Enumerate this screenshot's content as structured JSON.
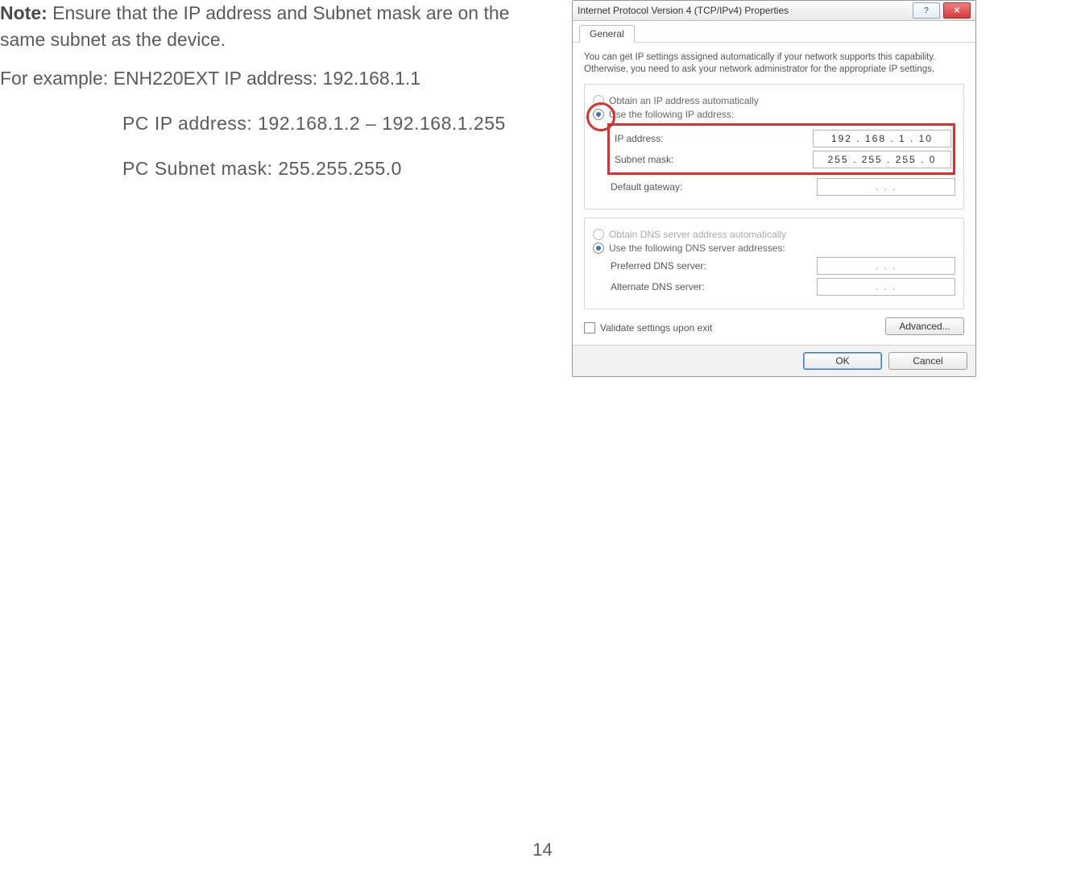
{
  "doc": {
    "note_label": "Note:",
    "note_text": " Ensure that the IP address and Subnet mask are on the same subnet as the device.",
    "example_prefix": "For example: ",
    "example_line": "ENH220EXT IP address: 192.168.1.1",
    "pc_ip_line": "PC IP address: 192.168.1.2 – 192.168.1.255",
    "pc_subnet_line": "PC Subnet mask: 255.255.255.0",
    "page_number": "14"
  },
  "dialog": {
    "title": "Internet Protocol Version 4 (TCP/IPv4) Properties",
    "help_symbol": "?",
    "close_symbol": "✕",
    "tab_general": "General",
    "description": "You can get IP settings assigned automatically if your network supports this capability. Otherwise, you need to ask your network administrator for the appropriate IP settings.",
    "radio_obtain_ip": "Obtain an IP address automatically",
    "radio_use_ip": "Use the following IP address:",
    "label_ip": "IP address:",
    "label_subnet": "Subnet mask:",
    "label_gateway": "Default gateway:",
    "value_ip": "192 . 168 .  1  . 10",
    "value_subnet": "255 . 255 . 255 .  0",
    "value_gateway": ".     .     .",
    "radio_obtain_dns": "Obtain DNS server address automatically",
    "radio_use_dns": "Use the following DNS server addresses:",
    "label_pref_dns": "Preferred DNS server:",
    "label_alt_dns": "Alternate DNS server:",
    "value_pref_dns": ".     .     .",
    "value_alt_dns": ".     .     .",
    "checkbox_validate": "Validate settings upon exit",
    "btn_advanced": "Advanced...",
    "btn_ok": "OK",
    "btn_cancel": "Cancel"
  }
}
